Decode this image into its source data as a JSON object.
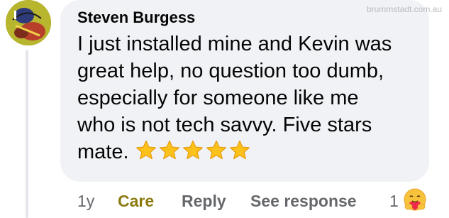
{
  "watermark": "brummstadt.com.au",
  "comment": {
    "author": "Steven Burgess",
    "lines": [
      "I just installed mine and Kevin was",
      "great help, no question too dumb,",
      "especially for someone like me",
      "who is not tech savvy. Five stars",
      "mate."
    ],
    "star_emoji_count": 5
  },
  "actions": {
    "time": "1y",
    "care": "Care",
    "reply": "Reply",
    "see_response": "See response"
  },
  "reactions": {
    "count": "1",
    "icon": "care-reaction-icon"
  },
  "colors": {
    "bubble": "#f0f2f5",
    "care_active": "#8c7a11",
    "secondary_text": "#65676b"
  }
}
